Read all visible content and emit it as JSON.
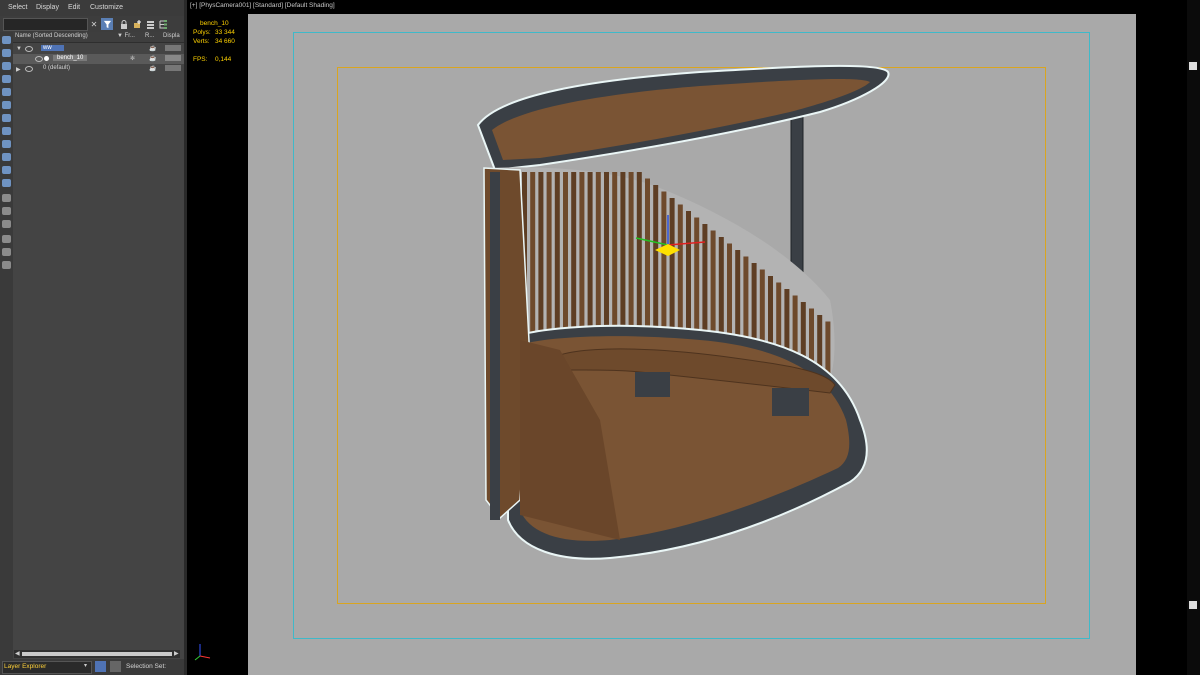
{
  "menu": {
    "select": "Select",
    "display": "Display",
    "edit": "Edit",
    "customize": "Customize"
  },
  "columns": {
    "name": "Name (Sorted Descending)",
    "frozen": "▼ Fr...",
    "render": "R...",
    "display": "Displa"
  },
  "tree": [
    {
      "label": "ww",
      "selected": true
    },
    {
      "label": "bench_10",
      "selected": true
    },
    {
      "label": "0 (default)",
      "selected": false
    }
  ],
  "bottom": {
    "layer_explorer": "Layer Explorer",
    "selection_set": "Selection Set:"
  },
  "viewport": {
    "label": "[+] [PhysCamera001] [Standard] [Default Shading]",
    "stats": {
      "object": "bench_10",
      "polys_label": "Polys:",
      "polys_value": "33 344",
      "verts_label": "Verts:",
      "verts_value": "34 660",
      "fps_label": "FPS:",
      "fps_value": "0,144"
    }
  },
  "icons": [
    "clear-search-icon",
    "filter-icon",
    "lock-icon",
    "add-layer-icon",
    "layer-stack-icon",
    "hierarchy-icon"
  ],
  "colors": {
    "viewport_bg": "#a9a9a9",
    "safe_frame": "#3fb9c9",
    "render_frame": "#d9a520",
    "stat_text": "#ffd200",
    "wood": "#6e4a2c"
  }
}
